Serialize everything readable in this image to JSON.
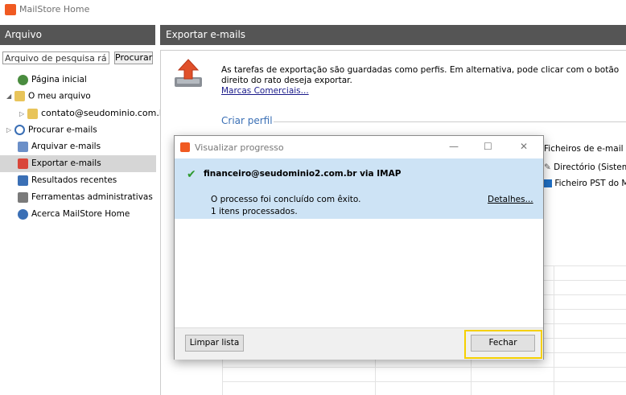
{
  "window": {
    "title": "MailStore Home"
  },
  "sidebar": {
    "header": "Arquivo",
    "search_placeholder": "Arquivo de pesquisa rápida",
    "search_button": "Procurar",
    "items": [
      {
        "label": "Página inicial",
        "icon": "home-icon"
      },
      {
        "label": "O meu arquivo",
        "icon": "folder-icon"
      },
      {
        "label": "contato@seudominio.com.br",
        "icon": "folder-icon"
      },
      {
        "label": "Procurar e-mails",
        "icon": "search-icon"
      },
      {
        "label": "Arquivar e-mails",
        "icon": "archive-icon"
      },
      {
        "label": "Exportar e-mails",
        "icon": "export-icon"
      },
      {
        "label": "Resultados recentes",
        "icon": "results-icon"
      },
      {
        "label": "Ferramentas administrativas",
        "icon": "tools-icon"
      },
      {
        "label": "Acerca MailStore Home",
        "icon": "info-icon"
      }
    ]
  },
  "main": {
    "header": "Exportar e-mails",
    "description": "As tarefas de exportação são guardadas como perfis. Em alternativa, pode clicar com o botão direito do rato deseja exportar.",
    "trademarks_link": "Marcas Comerciais...",
    "create_profile": "Criar perfil",
    "right_column": {
      "title": "Ficheiros de e-mail",
      "options": [
        "Directório (Sistema",
        "Ficheiro PST do Mi"
      ]
    }
  },
  "dialog": {
    "title": "Visualizar progresso",
    "account": "financeiro@seudominio2.com.br via IMAP",
    "result": "O processo foi concluído com êxito.",
    "processed": "1 itens processados.",
    "details_link": "Detalhes...",
    "clear_button": "Limpar lista",
    "close_button": "Fechar",
    "minimize": "—",
    "maximize": "☐",
    "close": "✕",
    "check_glyph": "✔"
  },
  "colors": {
    "header_bg": "#555555",
    "status_bg": "#cde3f5",
    "accent": "#3a6fb5",
    "highlight": "#f5d000",
    "brand": "#f05a22"
  }
}
